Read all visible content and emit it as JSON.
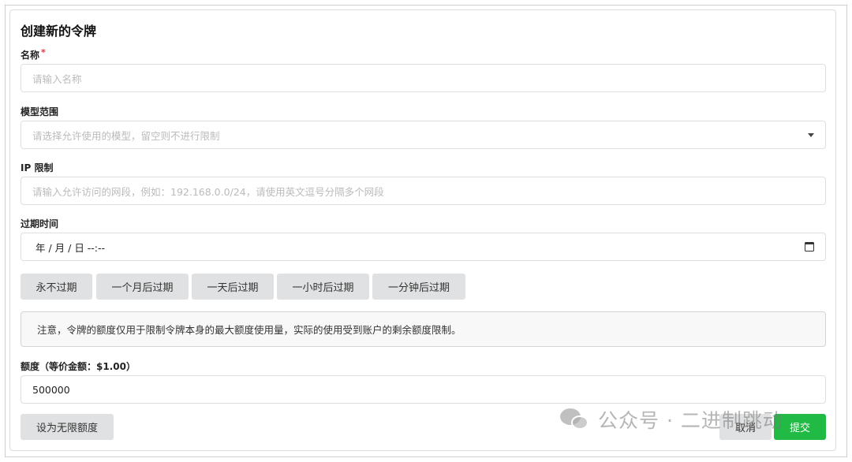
{
  "form": {
    "title": "创建新的令牌",
    "name": {
      "label": "名称",
      "required_mark": "*",
      "placeholder": "请输入名称"
    },
    "models": {
      "label": "模型范围",
      "placeholder": "请选择允许使用的模型，留空则不进行限制"
    },
    "ip": {
      "label": "IP 限制",
      "placeholder": "请输入允许访问的网段，例如：192.168.0.0/24，请使用英文逗号分隔多个网段"
    },
    "expiry": {
      "label": "过期时间",
      "value": "年 / 月 / 日 --:--",
      "quick_buttons": [
        "永不过期",
        "一个月后过期",
        "一天后过期",
        "一小时后过期",
        "一分钟后过期"
      ]
    },
    "notice": "注意，令牌的额度仅用于限制令牌本身的最大额度使用量，实际的使用受到账户的剩余额度限制。",
    "quota": {
      "label": "额度（等价金额：$1.00）",
      "value": "500000"
    },
    "unlimited_button": "设为无限额度",
    "cancel_button": "取消",
    "submit_button": "提交"
  },
  "watermark": {
    "text": "公众号 · 二进制跳动"
  },
  "colors": {
    "primary": "#21ba45",
    "button_gray": "#e0e1e2",
    "required": "#d9363e"
  },
  "icons": {
    "dropdown": "chevron-down-icon",
    "calendar": "calendar-icon",
    "wechat": "wechat-icon"
  }
}
